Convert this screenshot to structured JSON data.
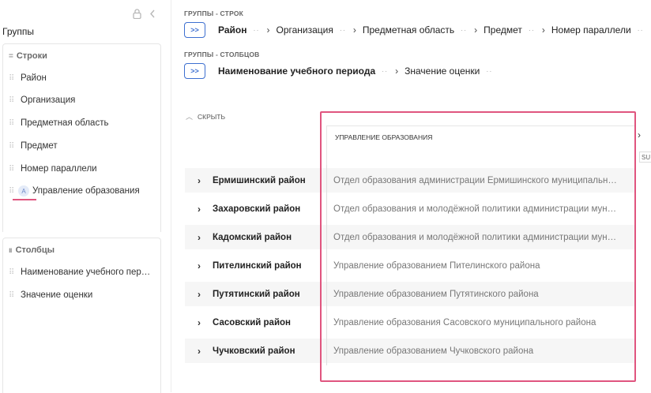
{
  "left_panel": {
    "title": "Группы",
    "rows_section": {
      "label": "Строки",
      "items": [
        "Район",
        "Организация",
        "Предметная область",
        "Предмет",
        "Номер параллели",
        "Управление образования"
      ],
      "badge": "A"
    },
    "cols_section": {
      "label": "Столбцы",
      "items": [
        "Наименование учебного пер…",
        "Значение оценки"
      ]
    }
  },
  "row_groups": {
    "label": "ГРУППЫ - СТРОК",
    "expand": ">>",
    "crumbs": [
      "Район",
      "Организация",
      "Предметная область",
      "Предмет",
      "Номер параллели"
    ]
  },
  "col_groups": {
    "label": "ГРУППЫ - СТОЛБЦОВ",
    "expand": ">>",
    "crumbs": [
      "Наименование учебного периода",
      "Значение оценки"
    ]
  },
  "hide_label": "СКРЫТЬ",
  "table": {
    "column_header": "УПРАВЛЕНИЕ ОБРАЗОВАНИЯ",
    "tab_fragment": "SU",
    "rows": [
      {
        "name": "Ермишинский район",
        "value": "Отдел образования администрации Ермишинского муниципальн…"
      },
      {
        "name": "Захаровский район",
        "value": "Отдел образования и молодёжной политики администрации мун…"
      },
      {
        "name": "Кадомский район",
        "value": "Отдел образования и молодёжной политики администрации мун…"
      },
      {
        "name": "Пителинский район",
        "value": "Управление образованием Пителинского района"
      },
      {
        "name": "Путятинский район",
        "value": "Управление образованием Путятинского района"
      },
      {
        "name": "Сасовский район",
        "value": "Управление образования Сасовского муниципального района"
      },
      {
        "name": "Чучковский район",
        "value": "Управление образованием Чучковского района"
      }
    ]
  },
  "colors": {
    "accent": "#3d6fd0",
    "highlight": "#e0557f"
  },
  "icons": [
    "lock-icon",
    "collapse-left-icon",
    "grip-icon",
    "chevron-right-icon",
    "chevron-up-icon"
  ]
}
